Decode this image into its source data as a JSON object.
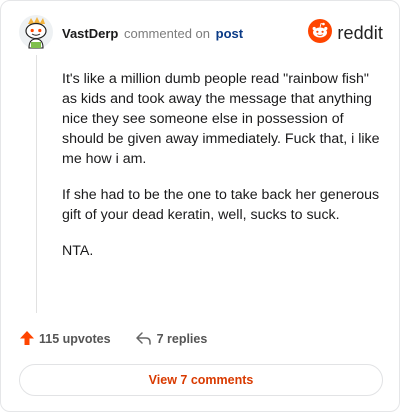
{
  "header": {
    "author": "VastDerp",
    "verb": "commented on",
    "post_link": "post",
    "brand": "reddit",
    "avatar_icon": "snoo-avatar-icon",
    "brand_icon": "reddit-logo-icon",
    "brand_color": "#ff4500"
  },
  "comment": {
    "paragraphs": [
      "It's like a million dumb people read \"rainbow fish\" as kids and took away the message that anything nice they see someone else in possession of should be given away immediately. Fuck that, i like me how i am.",
      "If she had to be the one to take back her generous gift of your dead keratin, well, sucks to suck.",
      "NTA."
    ]
  },
  "actions": {
    "upvotes": "115 upvotes",
    "replies": "7 replies",
    "upvote_icon": "upvote-arrow-icon",
    "reply_icon": "reply-arrow-icon",
    "upvote_color": "#ff4500"
  },
  "footer": {
    "view_label": "View 7 comments",
    "accent_color": "#d93a00"
  }
}
